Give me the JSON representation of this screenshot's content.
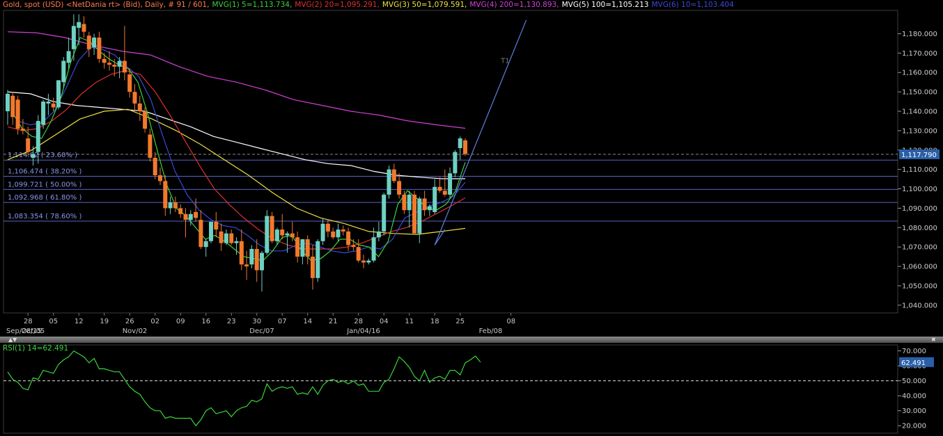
{
  "header": {
    "segments": [
      {
        "text": "Gold, spot (USD) <NetDania rt> (Bid), Daily, # 91 / 601,",
        "color": "#ff7b4d"
      },
      {
        "text": "MVG(1) 5=1,113.734,",
        "color": "#3bd33b"
      },
      {
        "text": "MVG(2) 20=1,095.291,",
        "color": "#e23030"
      },
      {
        "text": "MVG(3) 50=1,079.591,",
        "color": "#f0e040"
      },
      {
        "text": "MVG(4) 200=1,130.893,",
        "color": "#d040d8"
      },
      {
        "text": "MVG(5) 100=1,105.213",
        "color": "#ffffff"
      },
      {
        "text": "MVG(6) 10=1,103.404",
        "color": "#3a4ad8"
      }
    ]
  },
  "panel_controls": {
    "up_arrows": "▲▼",
    "close": "✖"
  },
  "chart_data": [
    {
      "type": "candlestick",
      "ylim": [
        1036,
        1192
      ],
      "yticks": [
        1040,
        1050,
        1060,
        1070,
        1080,
        1090,
        1100,
        1110,
        1120,
        1130,
        1140,
        1150,
        1160,
        1170,
        1180
      ],
      "ytick_labels": [
        "1,040.000",
        "1,050.000",
        "1,060.000",
        "1,070.000",
        "1,080.000",
        "1,090.000",
        "1,100.000",
        "1,110.000",
        "1,120.000",
        "1,130.000",
        "1,140.000",
        "1,150.000",
        "1,160.000",
        "1,170.000",
        "1,180.000"
      ],
      "last_price_label": "1,117.790",
      "last_price": 1117.79,
      "x_day_labels": [
        {
          "i": 4,
          "t": "28"
        },
        {
          "i": 9,
          "t": "05"
        },
        {
          "i": 14,
          "t": "12"
        },
        {
          "i": 19,
          "t": "19"
        },
        {
          "i": 24,
          "t": "26"
        },
        {
          "i": 29,
          "t": "02"
        },
        {
          "i": 34,
          "t": "09"
        },
        {
          "i": 39,
          "t": "16"
        },
        {
          "i": 44,
          "t": "23"
        },
        {
          "i": 49,
          "t": "30"
        },
        {
          "i": 54,
          "t": "07"
        },
        {
          "i": 59,
          "t": "14"
        },
        {
          "i": 64,
          "t": "21"
        },
        {
          "i": 69,
          "t": "28"
        },
        {
          "i": 74,
          "t": "04"
        },
        {
          "i": 79,
          "t": "11"
        },
        {
          "i": 84,
          "t": "18"
        },
        {
          "i": 89,
          "t": "25"
        },
        {
          "i": 99,
          "t": "08"
        }
      ],
      "x_period_labels": [
        {
          "i": 0,
          "t": "Sep/28/15"
        },
        {
          "i": 5,
          "t": "Oct/05"
        },
        {
          "i": 25,
          "t": "Nov/02"
        },
        {
          "i": 50,
          "t": "Dec/07"
        },
        {
          "i": 70,
          "t": "Jan/04/16"
        },
        {
          "i": 95,
          "t": "Feb/08"
        }
      ],
      "candles": [
        [
          1140,
          1151,
          1133,
          1149
        ],
        [
          1148,
          1150,
          1133,
          1137
        ],
        [
          1146,
          1148,
          1128,
          1131
        ],
        [
          1131,
          1136,
          1128,
          1130
        ],
        [
          1126,
          1132,
          1117,
          1119
        ],
        [
          1116,
          1122,
          1112,
          1118
        ],
        [
          1119,
          1138,
          1113,
          1135
        ],
        [
          1133,
          1146,
          1131,
          1145
        ],
        [
          1144,
          1149,
          1138,
          1145
        ],
        [
          1144,
          1147,
          1140,
          1142
        ],
        [
          1142,
          1156,
          1141,
          1156
        ],
        [
          1155,
          1168,
          1152,
          1166
        ],
        [
          1165,
          1178,
          1162,
          1171
        ],
        [
          1172,
          1190,
          1166,
          1184
        ],
        [
          1183,
          1190,
          1174,
          1186
        ],
        [
          1185,
          1189,
          1178,
          1181
        ],
        [
          1179,
          1181,
          1168,
          1172
        ],
        [
          1173,
          1180,
          1169,
          1178
        ],
        [
          1178,
          1181,
          1165,
          1167
        ],
        [
          1167,
          1170,
          1162,
          1165
        ],
        [
          1165,
          1171,
          1161,
          1164
        ],
        [
          1164,
          1167,
          1158,
          1163
        ],
        [
          1163,
          1168,
          1157,
          1166
        ],
        [
          1166,
          1184,
          1156,
          1160
        ],
        [
          1159,
          1162,
          1147,
          1150
        ],
        [
          1150,
          1154,
          1140,
          1144
        ],
        [
          1144,
          1148,
          1135,
          1140
        ],
        [
          1140,
          1142,
          1129,
          1131
        ],
        [
          1128,
          1131,
          1114,
          1116
        ],
        [
          1116,
          1119,
          1105,
          1107
        ],
        [
          1107,
          1111,
          1102,
          1104
        ],
        [
          1104,
          1107,
          1086,
          1090
        ],
        [
          1090,
          1096,
          1087,
          1093
        ],
        [
          1093,
          1096,
          1088,
          1090
        ],
        [
          1090,
          1092,
          1085,
          1087
        ],
        [
          1087,
          1090,
          1075,
          1084
        ],
        [
          1084,
          1089,
          1081,
          1087
        ],
        [
          1088,
          1095,
          1083,
          1085
        ],
        [
          1084,
          1089,
          1069,
          1070
        ],
        [
          1070,
          1074,
          1065,
          1073
        ],
        [
          1073,
          1083,
          1072,
          1083
        ],
        [
          1083,
          1088,
          1075,
          1079
        ],
        [
          1078,
          1082,
          1068,
          1072
        ],
        [
          1072,
          1079,
          1071,
          1077
        ],
        [
          1077,
          1079,
          1071,
          1072
        ],
        [
          1072,
          1075,
          1066,
          1073
        ],
        [
          1073,
          1079,
          1058,
          1061
        ],
        [
          1061,
          1068,
          1053,
          1060
        ],
        [
          1061,
          1071,
          1059,
          1069
        ],
        [
          1069,
          1074,
          1052,
          1058
        ],
        [
          1058,
          1068,
          1047,
          1067
        ],
        [
          1067,
          1089,
          1066,
          1086
        ],
        [
          1086,
          1088,
          1072,
          1073
        ],
        [
          1073,
          1080,
          1071,
          1079
        ],
        [
          1079,
          1087,
          1074,
          1076
        ],
        [
          1076,
          1078,
          1067,
          1077
        ],
        [
          1077,
          1083,
          1073,
          1075
        ],
        [
          1075,
          1078,
          1062,
          1065
        ],
        [
          1065,
          1073,
          1061,
          1074
        ],
        [
          1074,
          1076,
          1061,
          1065
        ],
        [
          1065,
          1071,
          1048,
          1054
        ],
        [
          1054,
          1074,
          1052,
          1073
        ],
        [
          1073,
          1085,
          1071,
          1082
        ],
        [
          1082,
          1084,
          1075,
          1078
        ],
        [
          1078,
          1080,
          1074,
          1075
        ],
        [
          1075,
          1082,
          1073,
          1079
        ],
        [
          1079,
          1081,
          1076,
          1078
        ],
        [
          1078,
          1080,
          1068,
          1071
        ],
        [
          1071,
          1074,
          1068,
          1070
        ],
        [
          1070,
          1074,
          1062,
          1063
        ],
        [
          1063,
          1066,
          1059,
          1062
        ],
        [
          1062,
          1064,
          1061,
          1063
        ],
        [
          1063,
          1080,
          1062,
          1075
        ],
        [
          1075,
          1083,
          1073,
          1078
        ],
        [
          1078,
          1098,
          1076,
          1097
        ],
        [
          1097,
          1112,
          1095,
          1110
        ],
        [
          1110,
          1113,
          1103,
          1104
        ],
        [
          1104,
          1108,
          1095,
          1097
        ],
        [
          1097,
          1099,
          1087,
          1089
        ],
        [
          1089,
          1099,
          1080,
          1097
        ],
        [
          1097,
          1099,
          1077,
          1077
        ],
        [
          1077,
          1096,
          1072,
          1095
        ],
        [
          1095,
          1099,
          1086,
          1089
        ],
        [
          1089,
          1092,
          1086,
          1091
        ],
        [
          1088,
          1105,
          1087,
          1101
        ],
        [
          1101,
          1106,
          1098,
          1099
        ],
        [
          1099,
          1110,
          1096,
          1097
        ],
        [
          1097,
          1111,
          1095,
          1108
        ],
        [
          1108,
          1120,
          1106,
          1119
        ],
        [
          1121,
          1127,
          1115,
          1126
        ],
        [
          1125,
          1126,
          1117,
          1118
        ]
      ],
      "moving_averages": [
        {
          "name": "MVG(4) 200",
          "color": "#d040d8",
          "start": 0,
          "values": [
            1181,
            1180.5,
            1178,
            1174,
            1171,
            1169,
            1163,
            1158,
            1155,
            1151,
            1146,
            1143,
            1140,
            1138,
            1135,
            1133,
            1131.2
          ]
        },
        {
          "name": "MVG(5) 100",
          "color": "#ffffff",
          "start": 0,
          "values": [
            1150,
            1149,
            1145,
            1143,
            1142,
            1141,
            1140,
            1136,
            1132,
            1127,
            1124,
            1121,
            1118,
            1115,
            1113,
            1112,
            1109,
            1107,
            1106,
            1105.2,
            1105.2
          ]
        },
        {
          "name": "MVG(3) 50",
          "color": "#f0e040",
          "start": 0,
          "values": [
            1115,
            1120,
            1128,
            1136,
            1140,
            1141,
            1136,
            1130,
            1123,
            1115,
            1107,
            1098,
            1090,
            1085,
            1082,
            1078,
            1077,
            1076.5,
            1078,
            1079.6
          ]
        },
        {
          "name": "MVG(2) 20",
          "color": "#e23030",
          "start": 0,
          "values": [
            1132,
            1130,
            1131,
            1135,
            1141,
            1149,
            1155,
            1159,
            1161,
            1159,
            1150,
            1138,
            1125,
            1112,
            1100,
            1092,
            1085,
            1079,
            1074,
            1071,
            1069,
            1069,
            1069,
            1070,
            1072,
            1075,
            1078,
            1080,
            1083,
            1087,
            1091,
            1095.3
          ]
        },
        {
          "name": "MVG(6) 10",
          "color": "#3a4ad8",
          "start": 2,
          "values": [
            1135,
            1133,
            1134,
            1140,
            1152,
            1166,
            1173,
            1172,
            1169,
            1163,
            1158,
            1146,
            1127,
            1109,
            1097,
            1089,
            1084,
            1081,
            1080,
            1076,
            1071,
            1068,
            1068,
            1071,
            1072,
            1070,
            1068,
            1067,
            1068,
            1070,
            1069,
            1074,
            1085,
            1088,
            1091,
            1093,
            1096,
            1103.4
          ]
        },
        {
          "name": "MVG(1) 5",
          "color": "#3bd33b",
          "start": 1,
          "values": [
            1139,
            1131,
            1127,
            1126,
            1135,
            1147,
            1165,
            1178,
            1176,
            1171,
            1167,
            1164,
            1162,
            1155,
            1139,
            1120,
            1102,
            1090,
            1086,
            1080,
            1074,
            1076,
            1073,
            1069,
            1065,
            1064,
            1063,
            1068,
            1075,
            1076,
            1068,
            1063,
            1064,
            1068,
            1074,
            1074,
            1071,
            1070,
            1065,
            1073,
            1092,
            1099,
            1095,
            1090,
            1089,
            1092,
            1099,
            1113.7
          ]
        }
      ],
      "fib_levels": [
        {
          "price": 1114.82,
          "label": "1,114.82 ( 23.60% )"
        },
        {
          "price": 1106.474,
          "label": "1,106.474 ( 38.20% )"
        },
        {
          "price": 1099.721,
          "label": "1,099.721 ( 50.00% )"
        },
        {
          "price": 1092.968,
          "label": "1,092.968 ( 61.80% )"
        },
        {
          "price": 1083.354,
          "label": "1,083.354 ( 78.60% )"
        }
      ],
      "trendlines": [
        {
          "from_i": 84,
          "from_p": 1071,
          "to_i": 102,
          "to_p": 1187,
          "label": "T1",
          "label_i": 97,
          "label_p": 1165
        },
        {
          "from_i": 84,
          "from_p": 1071,
          "to_i": 86,
          "to_p": 1079
        }
      ]
    },
    {
      "type": "line",
      "title": "RSI(1) 14=62.491",
      "ylim": [
        15,
        74
      ],
      "yticks": [
        20,
        30,
        40,
        50,
        60,
        70
      ],
      "ytick_labels": [
        "20.000",
        "30.000",
        "40.000",
        "50.000",
        "60.000",
        "70.000"
      ],
      "last_value_label": "62.491",
      "reference_line": 50,
      "values": [
        56,
        51,
        49,
        45,
        44,
        52,
        51,
        57,
        56,
        55,
        61,
        64,
        66,
        70,
        68,
        66,
        62,
        65,
        58,
        58,
        57,
        56,
        56,
        51,
        46,
        43,
        41,
        36,
        32,
        30,
        30,
        25,
        26,
        25,
        25,
        25,
        25,
        20,
        24,
        30,
        32,
        28,
        29,
        30,
        26,
        30,
        32,
        33,
        37,
        36,
        38,
        48,
        43,
        45,
        46,
        45,
        46,
        41,
        42,
        41,
        46,
        41,
        47,
        50,
        51,
        49,
        50,
        48,
        50,
        47,
        48,
        43,
        43,
        43,
        49,
        51,
        58,
        66,
        63,
        59,
        53,
        50,
        57,
        49,
        52,
        53,
        51,
        57,
        57,
        54,
        62,
        64,
        66.5,
        62.5
      ]
    }
  ]
}
